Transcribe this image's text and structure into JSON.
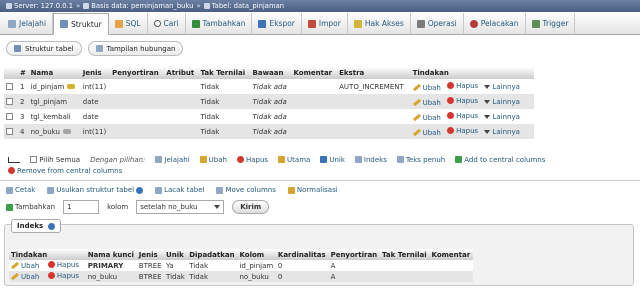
{
  "breadcrumb": {
    "server": "Server: 127.0.0.1",
    "database": "Basis data: peminjaman_buku",
    "table": "Tabel: data_pinjaman",
    "sep": "»"
  },
  "tabs": [
    {
      "label": "Jelajahi",
      "icon": "browse-icon"
    },
    {
      "label": "Struktur",
      "icon": "structure-icon",
      "active": true
    },
    {
      "label": "SQL",
      "icon": "sql-icon"
    },
    {
      "label": "Cari",
      "icon": "search-icon"
    },
    {
      "label": "Tambahkan",
      "icon": "insert-icon"
    },
    {
      "label": "Ekspor",
      "icon": "export-icon"
    },
    {
      "label": "Impor",
      "icon": "import-icon"
    },
    {
      "label": "Hak Akses",
      "icon": "privileges-icon"
    },
    {
      "label": "Operasi",
      "icon": "operations-icon"
    },
    {
      "label": "Pelacakan",
      "icon": "tracking-icon"
    },
    {
      "label": "Trigger",
      "icon": "trigger-icon"
    }
  ],
  "subtabs": {
    "structure": "Struktur tabel",
    "relations": "Tampilan hubungan"
  },
  "columns_table": {
    "headers": [
      "#",
      "Nama",
      "Jenis",
      "Penyortiran",
      "Atribut",
      "Tak Ternilai",
      "Bawaan",
      "Komentar",
      "Ekstra",
      "Tindakan"
    ],
    "rows": [
      {
        "num": "1",
        "name": "id_pinjam",
        "type": "int(11)",
        "collation": "",
        "attributes": "",
        "null": "Tidak",
        "default": "Tidak ada",
        "comment": "",
        "extra": "AUTO_INCREMENT",
        "key": "primary"
      },
      {
        "num": "2",
        "name": "tgl_pinjam",
        "type": "date",
        "collation": "",
        "attributes": "",
        "null": "Tidak",
        "default": "Tidak ada",
        "comment": "",
        "extra": "",
        "key": ""
      },
      {
        "num": "3",
        "name": "tgl_kembali",
        "type": "date",
        "collation": "",
        "attributes": "",
        "null": "Tidak",
        "default": "Tidak ada",
        "comment": "",
        "extra": "",
        "key": ""
      },
      {
        "num": "4",
        "name": "no_buku",
        "type": "int(11)",
        "collation": "",
        "attributes": "",
        "null": "Tidak",
        "default": "Tidak ada",
        "comment": "",
        "extra": "",
        "key": "index"
      }
    ],
    "actions": {
      "change": "Ubah",
      "drop": "Hapus",
      "more": "Lainnya"
    }
  },
  "bulk": {
    "check_all": "Pilih Semua",
    "with_selected": "Dengan pilihan:",
    "browse": "Jelajahi",
    "change": "Ubah",
    "drop": "Hapus",
    "primary": "Utama",
    "unique": "Unik",
    "index": "Indeks",
    "fulltext": "Teks penuh",
    "add_central": "Add to central columns",
    "remove_central": "Remove from central columns"
  },
  "links": {
    "print": "Cetak",
    "propose": "Usulkan struktur tabel",
    "track": "Lacak tabel",
    "move": "Move columns",
    "normalize": "Normalisasi"
  },
  "add_columns": {
    "label": "Tambahkan",
    "count": "1",
    "unit": "kolom",
    "position": "setelah no_buku",
    "submit": "Kirim"
  },
  "indexes": {
    "legend": "Indeks",
    "headers": [
      "Tindakan",
      "Nama kunci",
      "Jenis",
      "Unik",
      "Dipadatkan",
      "Kolom",
      "Kardinalitas",
      "Penyortiran",
      "Tak Ternilai",
      "Komentar"
    ],
    "rows": [
      {
        "key_name": "PRIMARY",
        "type": "BTREE",
        "unique": "Ya",
        "packed": "Tidak",
        "column": "id_pinjam",
        "cardinality": "0",
        "collation": "A",
        "null": "",
        "comment": ""
      },
      {
        "key_name": "no_buku",
        "type": "BTREE",
        "unique": "Tidak",
        "packed": "Tidak",
        "column": "no_buku",
        "cardinality": "0",
        "collation": "A",
        "null": "",
        "comment": ""
      }
    ],
    "actions": {
      "change": "Ubah",
      "drop": "Hapus"
    }
  }
}
